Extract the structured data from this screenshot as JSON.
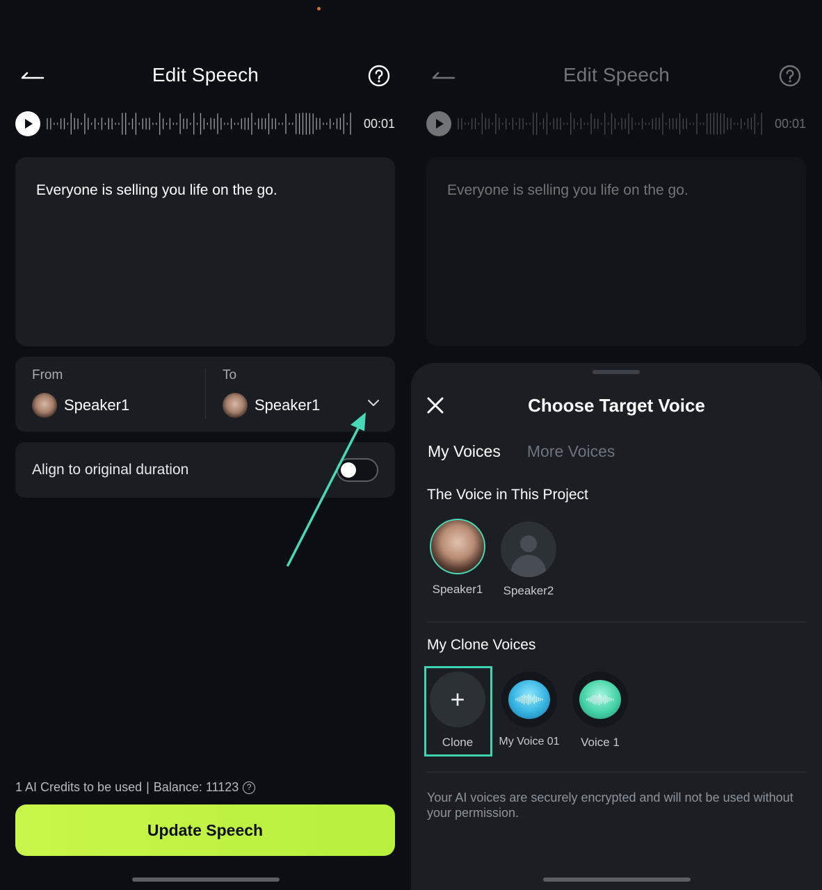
{
  "left": {
    "header": {
      "title": "Edit Speech"
    },
    "player": {
      "time": "00:01"
    },
    "text_editor": {
      "content": "Everyone is selling you life on the go."
    },
    "speakers": {
      "from_label": "From",
      "from_value": "Speaker1",
      "to_label": "To",
      "to_value": "Speaker1"
    },
    "align": {
      "label": "Align to original duration",
      "enabled": false
    },
    "credits": {
      "used": "1 AI Credits to be used",
      "separator": "|",
      "balance": "Balance: 11123"
    },
    "update_button": {
      "label": "Update Speech"
    },
    "colors": {
      "accent": "#c9f64a",
      "annotation": "#49d9b6"
    }
  },
  "right": {
    "header": {
      "title": "Edit Speech"
    },
    "player": {
      "time": "00:01"
    },
    "text_editor": {
      "content": "Everyone is selling you life on the go."
    },
    "sheet": {
      "title": "Choose Target Voice",
      "tabs": [
        {
          "label": "My Voices",
          "active": true
        },
        {
          "label": "More Voices",
          "active": false
        }
      ],
      "project_section": {
        "title": "The Voice in This Project",
        "voices": [
          {
            "name": "Speaker1",
            "selected": true
          },
          {
            "name": "Speaker2",
            "selected": false
          }
        ]
      },
      "clone_section": {
        "title": "My Clone Voices",
        "items": [
          {
            "name": "Clone",
            "icon": "plus-icon"
          },
          {
            "name": "My Voice 01",
            "icon": "waveform-blue-icon"
          },
          {
            "name": "Voice 1",
            "icon": "waveform-green-icon"
          }
        ]
      },
      "privacy_note": "Your AI voices are securely encrypted and will not be used without your permission."
    }
  }
}
